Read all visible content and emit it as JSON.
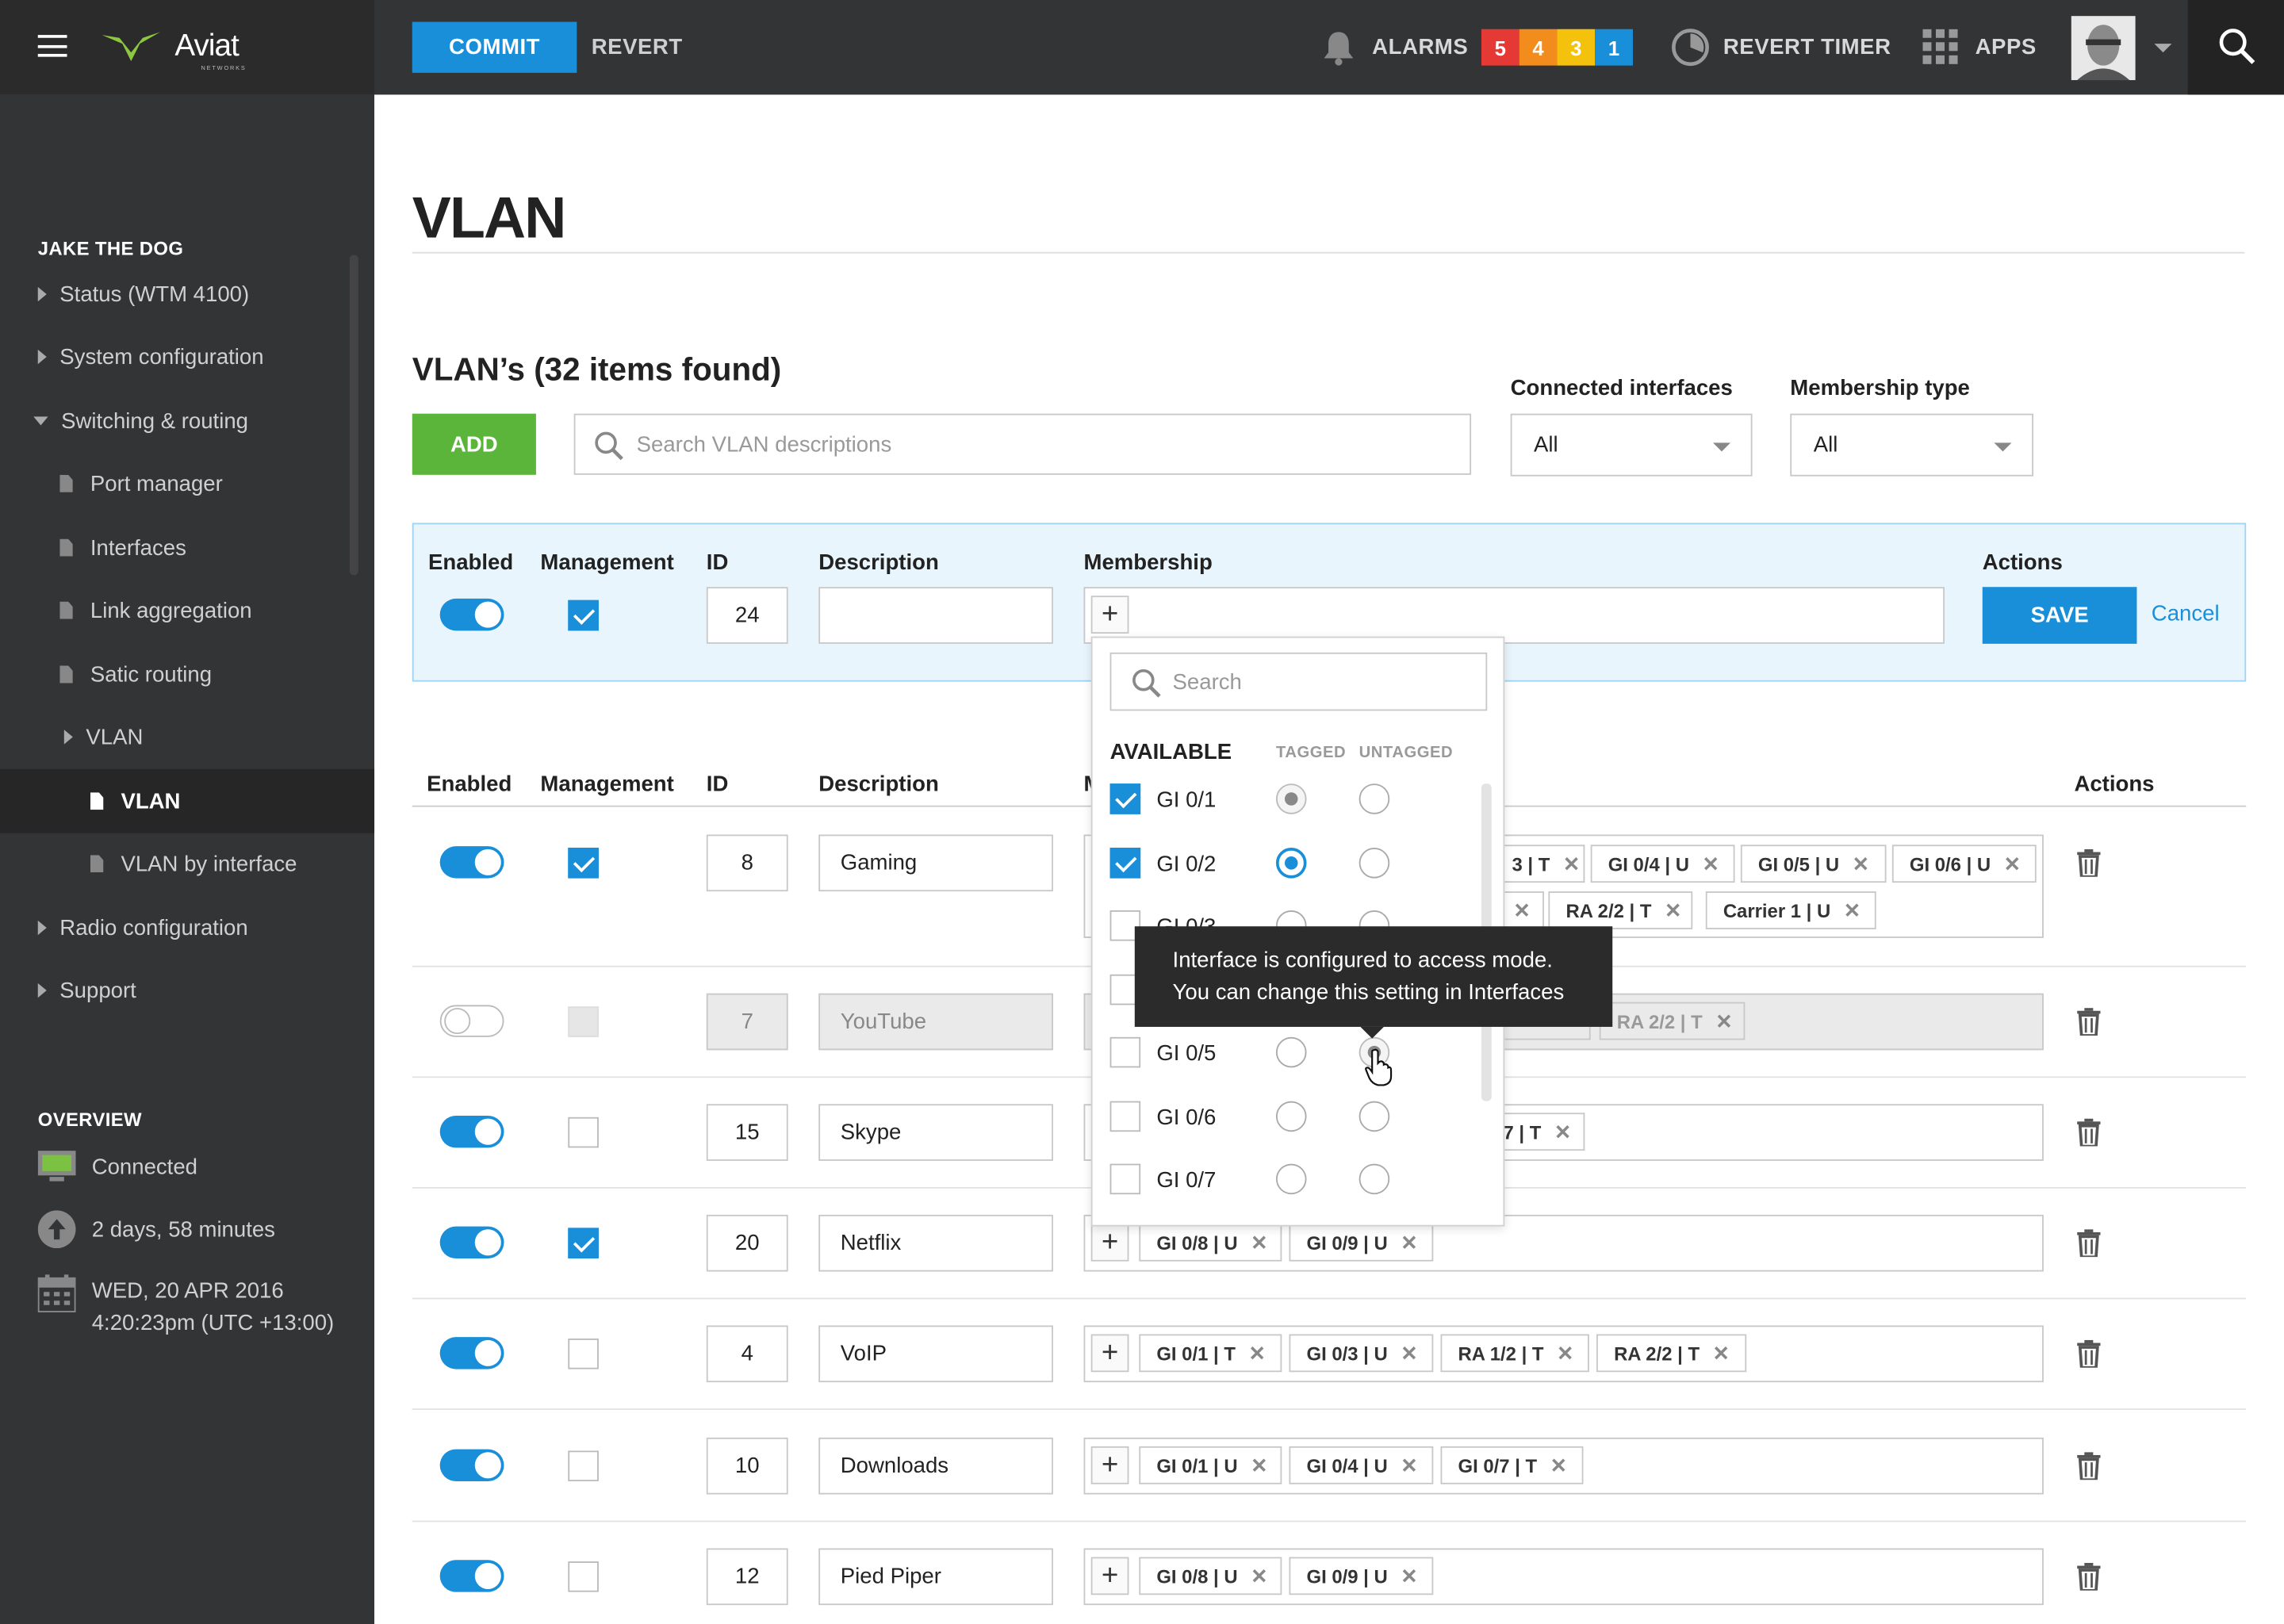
{
  "topbar": {
    "logo_text": "Aviat",
    "logo_sub": "NETWORKS",
    "commit_label": "COMMIT",
    "revert_label": "REVERT",
    "alarms_label": "ALARMS",
    "alarm_badges": [
      {
        "value": "5",
        "color": "#e53935"
      },
      {
        "value": "4",
        "color": "#f28c1c"
      },
      {
        "value": "3",
        "color": "#f4c20d"
      },
      {
        "value": "1",
        "color": "#1a8fd9"
      }
    ],
    "revert_timer_label": "REVERT TIMER",
    "apps_label": "APPS"
  },
  "sidebar": {
    "device_name": "JAKE THE DOG",
    "items": [
      {
        "label": "Status (WTM 4100)"
      },
      {
        "label": "System configuration"
      },
      {
        "label": "Switching & routing"
      },
      {
        "label": "Port manager"
      },
      {
        "label": "Interfaces"
      },
      {
        "label": "Link aggregation"
      },
      {
        "label": "Satic routing"
      },
      {
        "label": "VLAN"
      },
      {
        "label": "VLAN"
      },
      {
        "label": "VLAN by interface"
      },
      {
        "label": "Radio configuration"
      },
      {
        "label": "Support"
      }
    ],
    "overview": {
      "heading": "OVERVIEW",
      "connection": "Connected",
      "uptime": "2 days, 58 minutes",
      "date_line1": "WED, 20 APR 2016",
      "date_line2": "4:20:23pm (UTC +13:00)"
    }
  },
  "main": {
    "title": "VLAN",
    "list_title": "VLAN’s (32 items found)",
    "add_label": "ADD",
    "search_placeholder": "Search VLAN descriptions",
    "filters": {
      "connected_label": "Connected interfaces",
      "connected_value": "All",
      "membership_label": "Membership type",
      "membership_value": "All"
    },
    "columns": {
      "enabled": "Enabled",
      "management": "Management",
      "id": "ID",
      "description": "Description",
      "membership": "Membership",
      "actions": "Actions"
    },
    "edit_row": {
      "id": "24",
      "description": "",
      "save_label": "SAVE",
      "cancel_label": "Cancel"
    },
    "dropdown": {
      "search_placeholder": "Search",
      "available": "AVAILABLE",
      "tagged": "TAGGED",
      "untagged": "UNTAGGED",
      "items": [
        {
          "name": "GI 0/1",
          "checked": true,
          "tagged": "disabled",
          "untagged": "off"
        },
        {
          "name": "GI 0/2",
          "checked": true,
          "tagged": "on",
          "untagged": "off"
        },
        {
          "name": "GI 0/3",
          "checked": false,
          "tagged": "off",
          "untagged": "off"
        },
        {
          "name": "",
          "checked": false,
          "tagged": "off",
          "untagged": "off"
        },
        {
          "name": "GI 0/5",
          "checked": false,
          "tagged": "off",
          "untagged": "disabled"
        },
        {
          "name": "GI 0/6",
          "checked": false,
          "tagged": "off",
          "untagged": "off"
        },
        {
          "name": "GI 0/7",
          "checked": false,
          "tagged": "off",
          "untagged": "off"
        }
      ],
      "tooltip_line1": "Interface is configured to access mode.",
      "tooltip_line2": "You can change this setting in Interfaces"
    },
    "rows": [
      {
        "enabled": true,
        "management": true,
        "id": "8",
        "description": "Gaming",
        "tags_line1": [
          "3 | T",
          "GI 0/4 | U",
          "GI 0/5 | U",
          "GI 0/6 | U"
        ],
        "tags_line2": [
          "RA 2/2 | T",
          "Carrier 1 | U"
        ]
      },
      {
        "enabled": false,
        "management": false,
        "id": "7",
        "description": "YouTube",
        "tags": [
          "RA 2/2 | T"
        ]
      },
      {
        "enabled": true,
        "management": false,
        "id": "15",
        "description": "Skype",
        "tags": [
          "7 | T"
        ]
      },
      {
        "enabled": true,
        "management": true,
        "id": "20",
        "description": "Netflix",
        "tags": [
          "GI 0/8 | U",
          "GI 0/9 | U"
        ]
      },
      {
        "enabled": true,
        "management": false,
        "id": "4",
        "description": "VoIP",
        "tags": [
          "GI 0/1 | T",
          "GI 0/3 | U",
          "RA 1/2 | T",
          "RA 2/2 | T"
        ]
      },
      {
        "enabled": true,
        "management": false,
        "id": "10",
        "description": "Downloads",
        "tags": [
          "GI 0/1 | U",
          "GI 0/4 | U",
          "GI 0/7 | T"
        ]
      },
      {
        "enabled": true,
        "management": false,
        "id": "12",
        "description": "Pied Piper",
        "tags": [
          "GI 0/8 | U",
          "GI 0/9 | U"
        ]
      }
    ]
  }
}
